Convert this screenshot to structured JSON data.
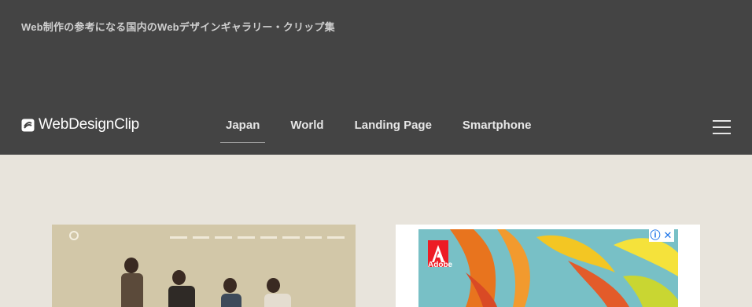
{
  "header": {
    "tagline": "Web制作の参考になる国内のWebデザインギャラリー・クリップ集",
    "logo_text": "WebDesignClip"
  },
  "nav": {
    "items": [
      {
        "label": "Japan",
        "active": true
      },
      {
        "label": "World",
        "active": false
      },
      {
        "label": "Landing Page",
        "active": false
      },
      {
        "label": "Smartphone",
        "active": false
      }
    ]
  },
  "ad": {
    "brand": "Adobe"
  },
  "colors": {
    "header_bg": "#444444",
    "page_bg": "#e8e4dc",
    "ad_bg": "#78c0c6"
  }
}
